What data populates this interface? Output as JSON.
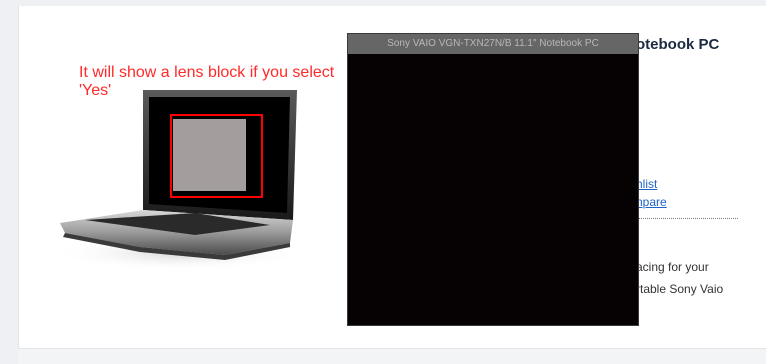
{
  "annotation": {
    "line1": "It will show a lens block if you select",
    "line2": "'Yes'"
  },
  "zoom_window": {
    "title": "Sony VAIO VGN-TXN27N/B 11.1\" Notebook PC"
  },
  "product": {
    "title_fragment": "otebook PC"
  },
  "links": {
    "wishlist_fragment": "hlist",
    "compare_fragment": "npare"
  },
  "description": {
    "line1_fragment": "acing for your",
    "line2_fragment": "rtable Sony Vaio"
  },
  "colors": {
    "annotation": "#ff2a2a",
    "lens_border": "#ff0000",
    "link": "#1f63c8",
    "zoom_header_bg": "#666666",
    "zoom_body_bg": "#060203"
  }
}
